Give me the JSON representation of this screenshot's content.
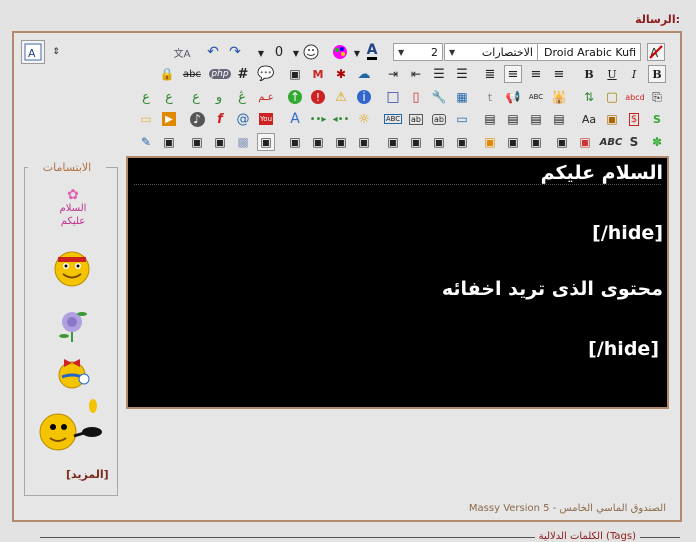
{
  "message_label": "الرسالة:",
  "toolbar": {
    "font_name": "Droid Arabic Kufi",
    "shortcuts": "الاختصارات",
    "font_size": "2",
    "bold": "B",
    "underline": "U",
    "italic": "I",
    "strike": "abc",
    "php": "php",
    "hash": "#",
    "code_ar": "عـم",
    "abc_text": "ABC",
    "aa_text": "Aa",
    "dollar": "$",
    "s_text": "S",
    "text_color": "A"
  },
  "editor": {
    "lines": [
      "السلام عليكم",
      "[hide/]",
      "محتوى الذى تريد اخفائه",
      "[hide/]"
    ]
  },
  "smilies": {
    "legend": "الابتسامات",
    "salam_text": "السلام عليكم",
    "more": "[المزيد]"
  },
  "footer": "Massy Version 5 - الصندوق الماسي الخامس",
  "tags_title": "الكلمات الدلالية (Tags)",
  "colors": {
    "accent": "#8b1a1a",
    "frame": "#b48a6e",
    "editor_bg": "#000000"
  }
}
